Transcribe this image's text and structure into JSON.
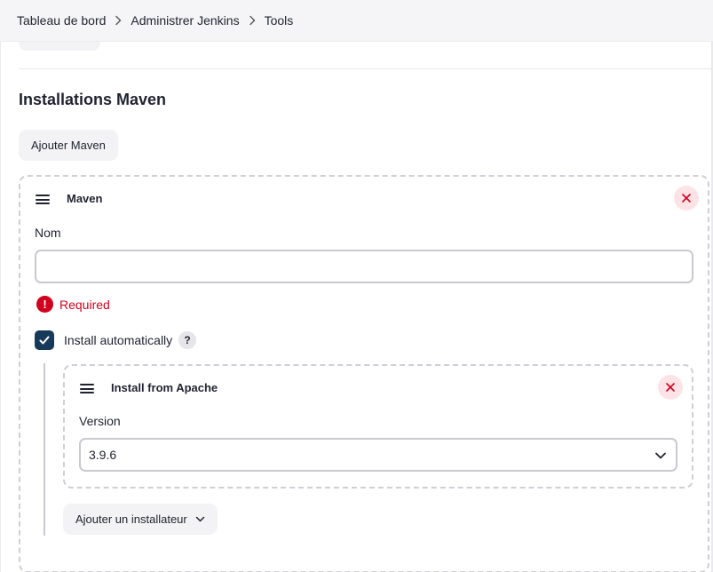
{
  "breadcrumb": {
    "items": [
      {
        "label": "Tableau de bord"
      },
      {
        "label": "Administrer Jenkins"
      },
      {
        "label": "Tools"
      }
    ]
  },
  "section": {
    "title": "Installations Maven",
    "add_button_label": "Ajouter Maven"
  },
  "maven_card": {
    "title": "Maven",
    "name_label": "Nom",
    "name_value": "",
    "error_text": "Required",
    "error_icon_glyph": "!",
    "install_auto_label": "Install automatically",
    "install_auto_checked": true,
    "help_glyph": "?"
  },
  "installer_card": {
    "title": "Install from Apache",
    "version_label": "Version",
    "version_selected": "3.9.6"
  },
  "add_installer_label": "Ajouter un installateur",
  "colors": {
    "accent_checkbox": "#173a5b",
    "error": "#d2001f",
    "close_bg": "#fde3e6",
    "close_icon": "#d2001f"
  },
  "icons": {
    "breadcrumb_separator": "chevron-right-icon",
    "drag": "drag-handle-icon",
    "close": "close-icon",
    "error": "error-icon",
    "check": "check-icon",
    "help": "help-icon",
    "dropdown": "chevron-down-icon"
  }
}
